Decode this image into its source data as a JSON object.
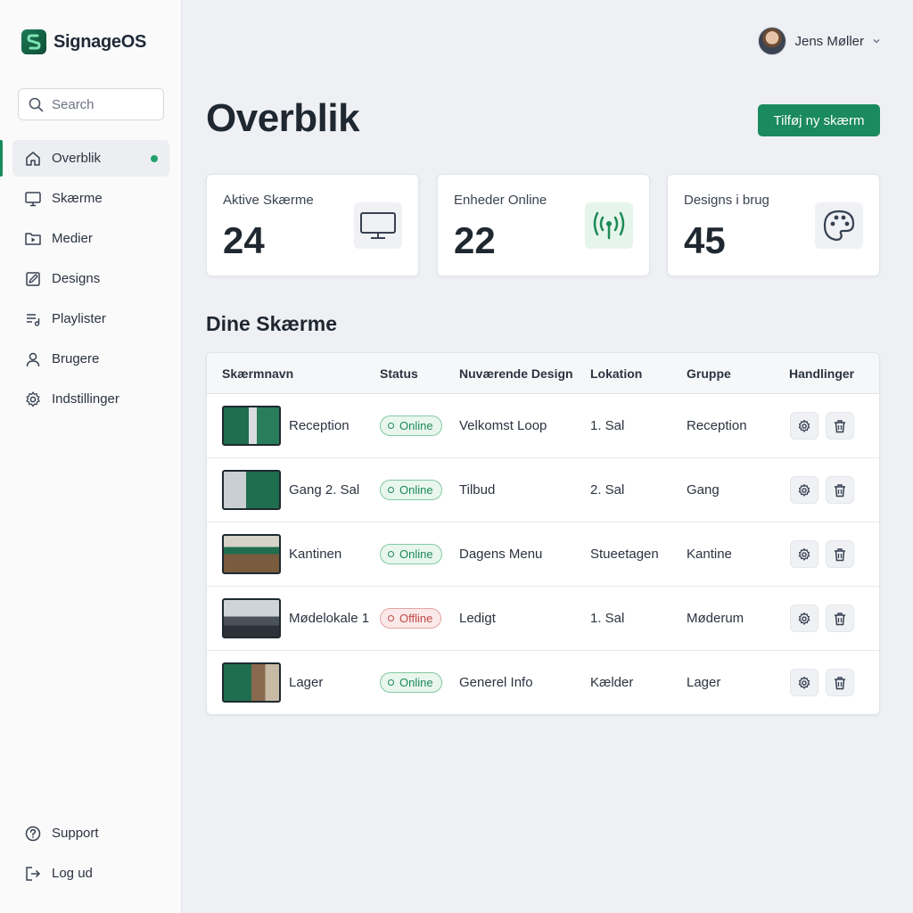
{
  "app": {
    "name": "SignageOS"
  },
  "search": {
    "placeholder": "Search"
  },
  "sidebar": {
    "items": [
      {
        "label": "Overblik"
      },
      {
        "label": "Skærme"
      },
      {
        "label": "Medier"
      },
      {
        "label": "Designs"
      },
      {
        "label": "Playlister"
      },
      {
        "label": "Brugere"
      },
      {
        "label": "Indstillinger"
      }
    ],
    "bottom": [
      {
        "label": "Support"
      },
      {
        "label": "Log ud"
      }
    ]
  },
  "user": {
    "name": "Jens Møller"
  },
  "page": {
    "title": "Overblik",
    "add_button": "Tilføj ny skærm"
  },
  "stats": [
    {
      "label": "Aktive Skærme",
      "value": "24"
    },
    {
      "label": "Enheder Online",
      "value": "22"
    },
    {
      "label": "Designs i brug",
      "value": "45"
    }
  ],
  "screens": {
    "title": "Dine Skærme",
    "columns": [
      "Skærmnavn",
      "Status",
      "Nuværende Design",
      "Lokation",
      "Gruppe",
      "Handlinger"
    ],
    "rows": [
      {
        "name": "Reception",
        "status": "Online",
        "design": "Velkomst Loop",
        "location": "1. Sal",
        "group": "Reception"
      },
      {
        "name": "Gang 2. Sal",
        "status": "Online",
        "design": "Tilbud",
        "location": "2. Sal",
        "group": "Gang"
      },
      {
        "name": "Kantinen",
        "status": "Online",
        "design": "Dagens Menu",
        "location": "Stueetagen",
        "group": "Kantine"
      },
      {
        "name": "Mødelokale 1",
        "status": "Offline",
        "design": "Ledigt",
        "location": "1. Sal",
        "group": "Møderum"
      },
      {
        "name": "Lager",
        "status": "Online",
        "design": "Generel Info",
        "location": "Kælder",
        "group": "Lager"
      }
    ]
  },
  "colors": {
    "accent": "#1b8a5f",
    "online": "#1d8a55",
    "offline": "#c24848"
  }
}
